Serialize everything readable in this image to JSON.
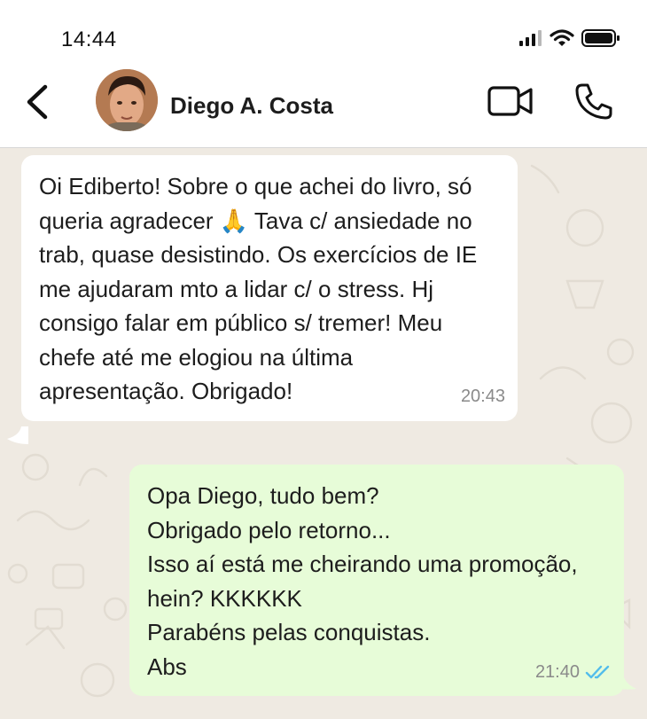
{
  "status_bar": {
    "time": "14:44",
    "icons": [
      "signal-icon",
      "wifi-icon",
      "battery-icon"
    ]
  },
  "header": {
    "contact_name": "Diego A. Costa",
    "icons": [
      "back-arrow-icon",
      "video-call-icon",
      "phone-icon"
    ]
  },
  "messages": [
    {
      "direction": "incoming",
      "text": "Oi Ediberto! Sobre o que achei do livro, só queria agradecer 🙏 Tava c/ ansiedade no trab, quase desistindo. Os exercícios de IE me ajudaram mto a lidar c/ o stress. Hj consigo falar em público s/ tremer! Meu chefe até me elogiou na última apresentação. Obrigado!",
      "time": "20:43"
    },
    {
      "direction": "outgoing",
      "text": "Opa Diego, tudo bem?\nObrigado pelo retorno...\nIsso aí está me cheirando uma promoção, hein? KKKKKK\nParabéns pelas conquistas.\nAbs",
      "time": "21:40",
      "read_receipt": "double-check-icon"
    }
  ],
  "colors": {
    "chat_background": "#efeae2",
    "incoming_bubble": "#ffffff",
    "outgoing_bubble": "#e7fcd8",
    "read_receipt": "#53bdeb"
  }
}
